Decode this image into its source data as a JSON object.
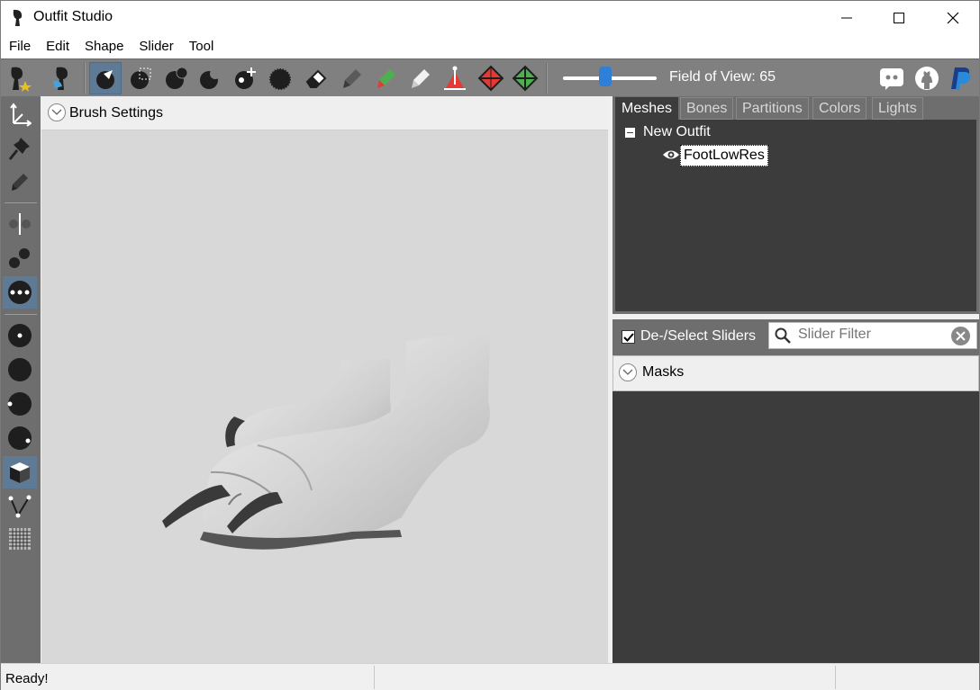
{
  "window": {
    "title": "Outfit Studio"
  },
  "menu": [
    "File",
    "Edit",
    "Shape",
    "Slider",
    "Tool"
  ],
  "toolbar": {
    "fov_label": "Field of View: 65",
    "fov_value": 65,
    "tools": [
      "reference-outfit-icon",
      "load-outfit-icon",
      "select-brush-icon",
      "mask-brush-icon",
      "inflate-brush-icon",
      "deflate-brush-icon",
      "move-brush-icon",
      "smooth-brush-icon",
      "undiff-brush-icon",
      "weight-paint-icon",
      "color-paint-icon",
      "alpha-paint-icon",
      "transform-icon",
      "pivot-icon",
      "vertex-select-icon"
    ],
    "links": [
      "discord-icon",
      "github-icon",
      "paypal-icon"
    ]
  },
  "left_tools": [
    "transform-axes-icon",
    "pin-icon",
    "pen-icon",
    "mirror-icon",
    "dots-icon",
    "vertices-icon",
    "sphere-small-icon",
    "sphere-icon",
    "sphere-left-icon",
    "sphere-right-icon",
    "cube-icon",
    "edge-icon",
    "grid-icon"
  ],
  "brush_settings": {
    "label": "Brush Settings"
  },
  "tabs": [
    {
      "label": "Meshes",
      "active": true
    },
    {
      "label": "Bones",
      "active": false
    },
    {
      "label": "Partitions",
      "active": false
    },
    {
      "label": "Colors",
      "active": false
    },
    {
      "label": "Lights",
      "active": false
    }
  ],
  "tree": {
    "root": "New Outfit",
    "children": [
      "FootLowRes"
    ]
  },
  "sliders": {
    "deselect_label": "De-/Select Sliders",
    "deselect_checked": true,
    "filter_placeholder": "Slider Filter",
    "masks_label": "Masks"
  },
  "status": {
    "text": "Ready!"
  },
  "colors": {
    "toolbar_bg": "#808080",
    "panel_dark": "#3c3c3c",
    "active_tool": "#5f7a95",
    "slider_accent": "#2f7fd8"
  }
}
